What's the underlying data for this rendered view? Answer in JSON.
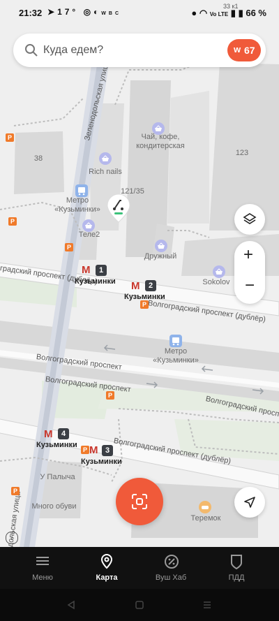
{
  "status": {
    "time": "21:32",
    "temp": "17°",
    "battery": "66 %",
    "small_label": "33 к1",
    "carrier_badge": "WBC",
    "network": "Vo LTE"
  },
  "search": {
    "placeholder": "Куда едем?",
    "points_symbol": "w",
    "points": "67"
  },
  "map": {
    "poi_cafe": "Чай, кофе,\nкондитерская",
    "poi_nails": "Rich nails",
    "building_38": "38",
    "building_123": "123",
    "building_121": "121/35",
    "metro_stop": "Метро\n«Кузьминки»",
    "metro_stop_2": "Метро\n«Кузьминки»",
    "tele2": "Теле2",
    "druzhny": "Дружный",
    "sokolov": "Sokolov",
    "street_zelenodolskaya": "Зеленодольская улица",
    "street_zelenodolskaya_2": "одольская улица",
    "street_volg_dubler_1": "градский проспект (дублёр)",
    "street_volg_dubler_2": "Волгоградский проспект (дублёр)",
    "street_volg_1": "Волгоградский проспект",
    "street_volg_2": "Волгоградский проспект",
    "street_volg_3": "Волгоградский проспект",
    "street_volg_dubler_3": "Волгоградский проспект (дублёр)",
    "u_palycha": "У Палыча",
    "mnogo_obuvi": "Много обуви",
    "teremok": "Теремок",
    "metro_name": "Кузьминки",
    "entrance_1": "1",
    "entrance_2": "2",
    "entrance_3": "3",
    "entrance_4": "4"
  },
  "tabs": [
    {
      "label": "Меню",
      "icon": "menu-icon"
    },
    {
      "label": "Карта",
      "icon": "map-pin-icon"
    },
    {
      "label": "Вуш Хаб",
      "icon": "percent-icon"
    },
    {
      "label": "ПДД",
      "icon": "shield-icon"
    }
  ],
  "colors": {
    "accent": "#f05a3a",
    "metro_red": "#c9372c",
    "parking": "#f07a2a",
    "tabbar": "#111111"
  }
}
